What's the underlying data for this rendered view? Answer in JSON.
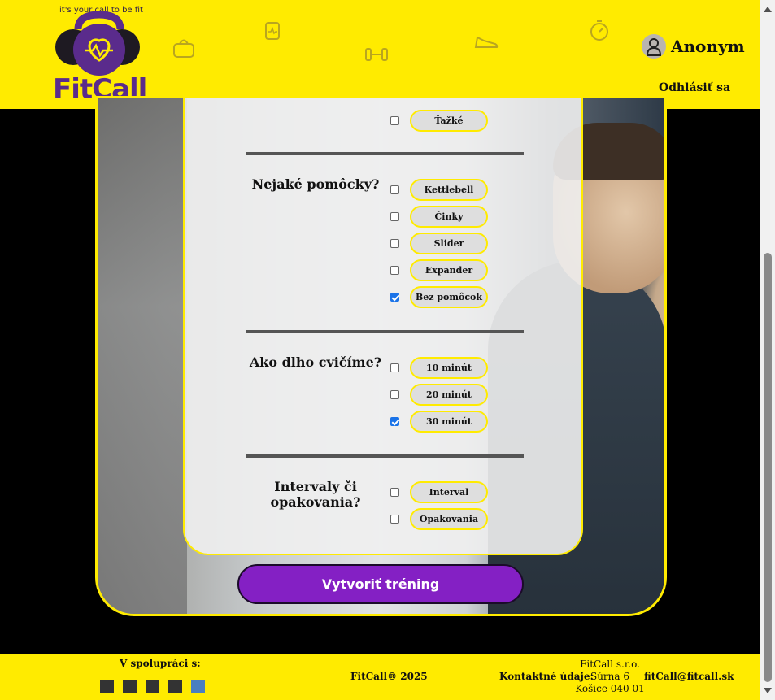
{
  "header": {
    "tagline": "it's your call to be fit",
    "brand": "FitCall",
    "user_name": "Anonym",
    "logout_label": "Odhlásiť sa"
  },
  "form": {
    "top_option": {
      "label": "Ťažké",
      "checked": false
    },
    "questions": [
      {
        "label": "Nejaké pomôcky?",
        "options": [
          {
            "label": "Kettlebell",
            "checked": false
          },
          {
            "label": "Činky",
            "checked": false
          },
          {
            "label": "Slider",
            "checked": false
          },
          {
            "label": "Expander",
            "checked": false
          },
          {
            "label": "Bez pomôcok",
            "checked": true
          }
        ]
      },
      {
        "label": "Ako dlho cvičíme?",
        "options": [
          {
            "label": "10 minút",
            "checked": false
          },
          {
            "label": "20 minút",
            "checked": false
          },
          {
            "label": "30 minút",
            "checked": true
          }
        ]
      },
      {
        "label": "Intervaly či opakovania?",
        "options": [
          {
            "label": "Interval",
            "checked": false
          },
          {
            "label": "Opakovania",
            "checked": false
          }
        ]
      }
    ],
    "submit_label": "Vytvoriť tréning"
  },
  "footer": {
    "partners_label": "V spolupráci s:",
    "copyright": "FitCall® 2025",
    "contact_label": "Kontaktné údaje:",
    "company": "FitCall s.r.o.",
    "street": "Súrna 6",
    "city": "Košice 040 01",
    "email": "fitCall@fitcall.sk"
  },
  "colors": {
    "header_bg": "#ffeb00",
    "accent_purple": "#8420c4",
    "brand_purple": "#5a2b8c"
  }
}
